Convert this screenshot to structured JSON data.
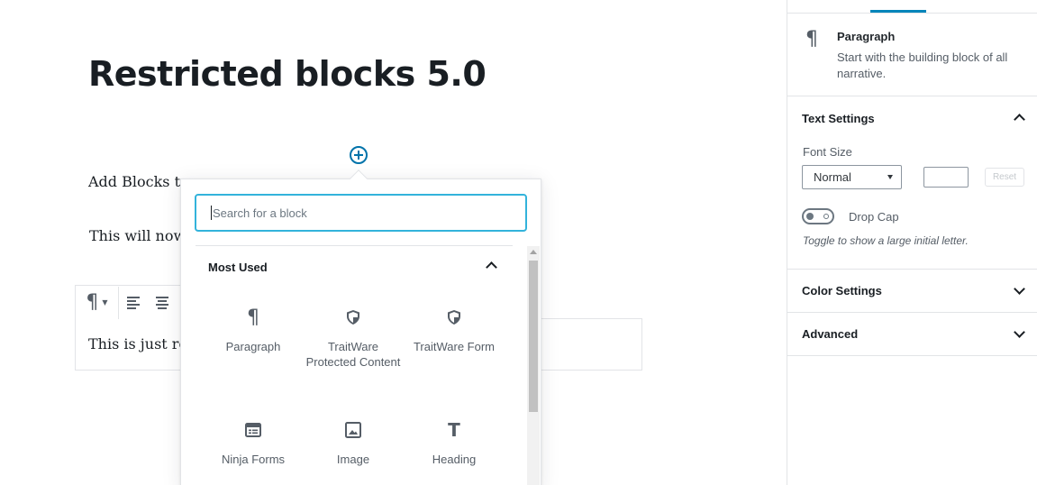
{
  "editor": {
    "post_title": "Restricted blocks 5.0",
    "paragraphs": [
      "Add Blocks to",
      "This will now",
      "This is just re"
    ]
  },
  "inserter": {
    "search_placeholder": "Search for a block",
    "panel_title": "Most Used",
    "blocks": [
      {
        "label": "Paragraph",
        "icon": "paragraph-icon"
      },
      {
        "label": "TraitWare Protected Content",
        "icon": "shield-icon"
      },
      {
        "label": "TraitWare Form",
        "icon": "shield-icon"
      },
      {
        "label": "Ninja Forms",
        "icon": "form-icon"
      },
      {
        "label": "Image",
        "icon": "image-icon"
      },
      {
        "label": "Heading",
        "icon": "heading-icon"
      }
    ]
  },
  "sidebar": {
    "block_card": {
      "title": "Paragraph",
      "description": "Start with the building block of all narrative."
    },
    "text_settings": {
      "title": "Text Settings",
      "font_size_label": "Font Size",
      "font_size_value": "Normal",
      "reset_label": "Reset",
      "drop_cap_label": "Drop Cap",
      "drop_cap_help": "Toggle to show a large initial letter."
    },
    "color_settings": {
      "title": "Color Settings"
    },
    "advanced": {
      "title": "Advanced"
    }
  },
  "colors": {
    "accent": "#0073aa",
    "search_focus": "#33b3db",
    "tab_active": "#0085ba"
  }
}
